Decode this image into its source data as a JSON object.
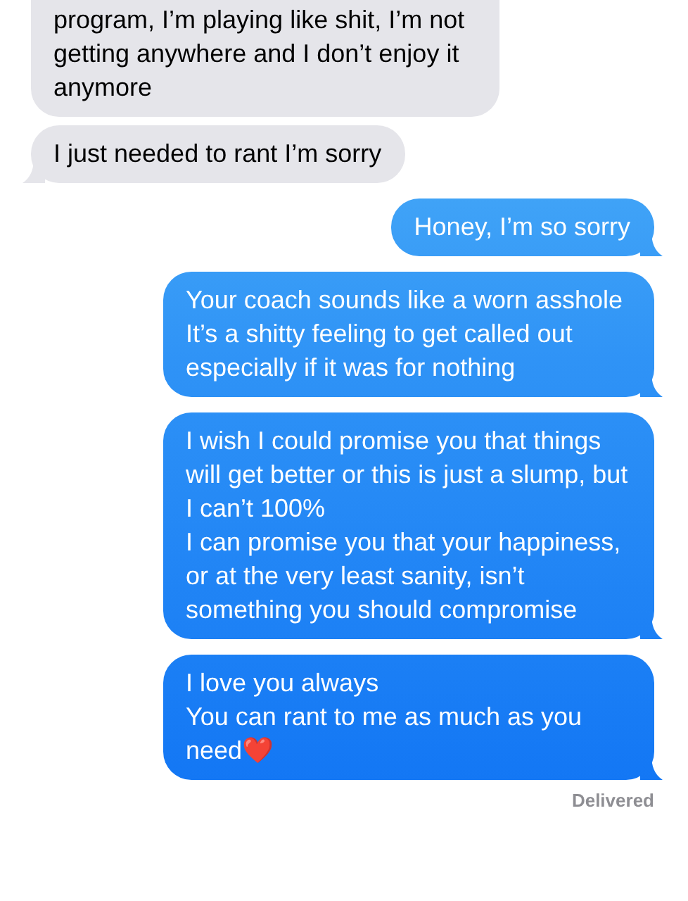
{
  "messages": [
    {
      "kind": "received",
      "tail": false,
      "lines": [
        "program, I’m playing like shit, I’m not getting anywhere and I don’t enjoy it anymore"
      ]
    },
    {
      "kind": "received",
      "tail": true,
      "lines": [
        "I just needed to rant I’m sorry"
      ]
    },
    {
      "kind": "sent",
      "tail": true,
      "lines": [
        "Honey, I’m so sorry"
      ]
    },
    {
      "kind": "sent",
      "tail": true,
      "lines": [
        "Your coach sounds like a worn asshole",
        "It’s a shitty feeling to get called out especially if it was for nothing"
      ]
    },
    {
      "kind": "sent",
      "tail": true,
      "lines": [
        "I wish I could promise you that things will get better or this is just a slump, but I can’t 100%",
        "I can promise you that your happiness, or at the very least sanity, isn’t something you should compromise"
      ]
    },
    {
      "kind": "sent",
      "tail": true,
      "lines": [
        "I love you always",
        "You can rant to me as much as you need❤️"
      ]
    }
  ],
  "status": "Delivered"
}
